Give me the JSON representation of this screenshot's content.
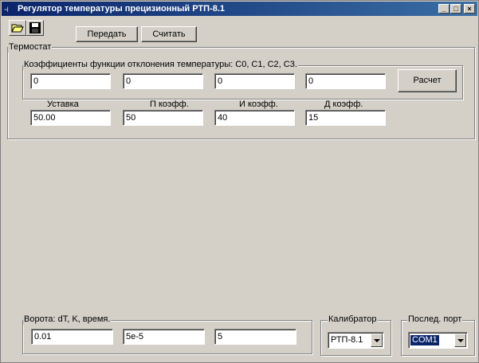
{
  "window": {
    "title": "Регулятор температуры прецизионный РТП-8.1"
  },
  "toolbar": {
    "send_label": "Передать",
    "read_label": "Считать"
  },
  "thermostat": {
    "legend": "Термостат",
    "coef_legend": "Коэффициенты функции отклонения температуры: C0, C1, C2, C3.",
    "coef_values": [
      "0",
      "0",
      "0",
      "0"
    ],
    "calc_label": "Расчет",
    "labels": {
      "setpoint": "Уставка",
      "p": "П коэфф.",
      "i": "И коэфф.",
      "d": "Д коэфф."
    },
    "values": {
      "setpoint": "50.00",
      "p": "50",
      "i": "40",
      "d": "15"
    }
  },
  "gate": {
    "legend": "Ворота: dT, K, время.",
    "values": [
      "0.01",
      "5e-5",
      "5"
    ]
  },
  "calibrator": {
    "legend": "Калибратор",
    "selected": "РТП-8.1"
  },
  "port": {
    "legend": "Послед. порт",
    "selected": "COM1"
  }
}
